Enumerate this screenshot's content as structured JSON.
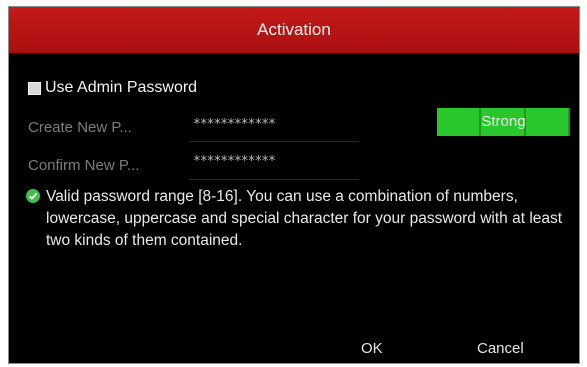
{
  "dialog": {
    "title": "Activation",
    "use_admin_password_label": "Use Admin Password",
    "use_admin_password_checked": true,
    "fields": [
      {
        "label": "Create New P...",
        "value": "************"
      },
      {
        "label": "Confirm New P...",
        "value": "************"
      }
    ],
    "strength_label": "Strong",
    "strength_color": "#29c72b",
    "info_text": "Valid password range [8-16]. You can use a combination of numbers, lowercase, uppercase and special character for your password with at least two kinds of them contained.",
    "ok_label": "OK",
    "cancel_label": "Cancel",
    "title_color": "#b81515"
  }
}
